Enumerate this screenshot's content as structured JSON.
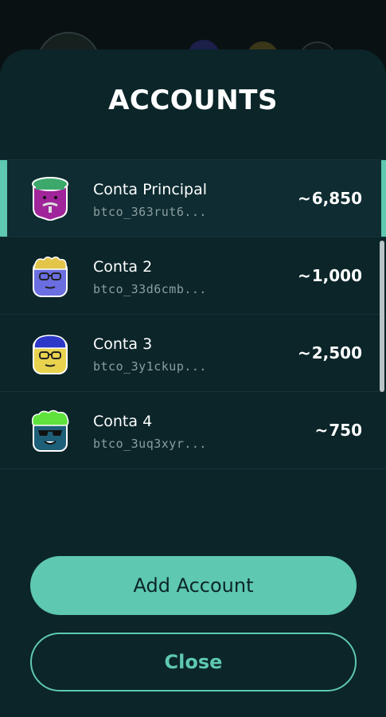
{
  "sheet": {
    "title": "ACCOUNTS"
  },
  "accounts": [
    {
      "name": "Conta Principal",
      "address": "btco_363rut6...",
      "balance": "6,850",
      "selected": true,
      "avatar": "farmer-purple-icon"
    },
    {
      "name": "Conta 2",
      "address": "btco_33d6cmb...",
      "balance": "1,000",
      "selected": false,
      "avatar": "blonde-glasses-icon"
    },
    {
      "name": "Conta 3",
      "address": "btco_3y1ckup...",
      "balance": "2,500",
      "selected": false,
      "avatar": "blue-hair-yellow-icon"
    },
    {
      "name": "Conta 4",
      "address": "btco_3uq3xyr...",
      "balance": "750",
      "selected": false,
      "avatar": "green-hair-sunglasses-icon"
    }
  ],
  "buttons": {
    "add_account": "Add Account",
    "close": "Close"
  },
  "balance_prefix": "~",
  "colors": {
    "accent": "#5ec8b0",
    "sheet_bg": "#0b2529",
    "text": "#ffffff",
    "muted": "#8a9ea0"
  }
}
